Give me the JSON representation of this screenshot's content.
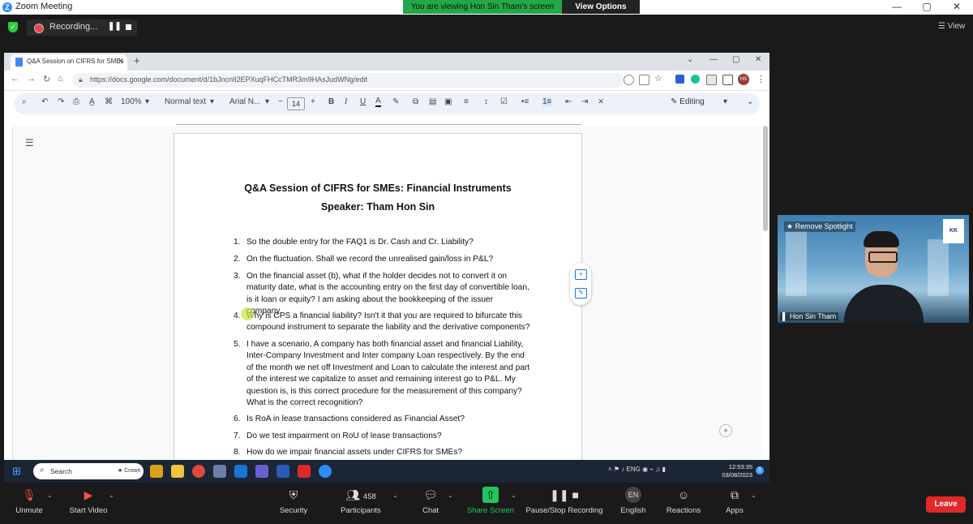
{
  "zoom": {
    "title": "Zoom Meeting",
    "logo": "Z",
    "viewing_banner": "You are viewing Hon Sin Tham's screen",
    "view_options": "View Options",
    "recording_label": "Recording...",
    "view_menu": "☰ View",
    "minimize": "—",
    "maximize": "▢",
    "close": "✕"
  },
  "browser": {
    "tab_title": "Q&A Session on CIFRS for SMEs",
    "tab_close": "✕",
    "new_tab": "+",
    "url": "https://docs.google.com/document/d/1bJncnlI2EPXuqFHCcTMR3m9HAsJudWNg/edit",
    "profile_initials": "HS",
    "back": "←",
    "forward": "→",
    "reload": "↻",
    "home": "⌂",
    "window_controls": [
      "⌄",
      "—",
      "▢",
      "✕"
    ]
  },
  "docs_toolbar": {
    "search": "⌕",
    "undo": "↶",
    "redo": "↷",
    "print": "⎙",
    "spellcheck": "A̲",
    "paint_format": "⌘",
    "zoom": "100%",
    "style": "Normal text",
    "font": "Arial N...",
    "minus": "−",
    "font_size": "14",
    "plus": "+",
    "bold": "B",
    "italic": "I",
    "underline": "U",
    "text_color": "A",
    "highlight": "✎",
    "link": "⧉",
    "comment": "▤",
    "image": "▣",
    "align": "≡",
    "line_spacing": "↕",
    "checklist": "☑",
    "bullets": "•≡",
    "numbered": "1≡",
    "indent_less": "⇤",
    "indent_more": "⇥",
    "clear_format": "⨯",
    "editing": "✎  Editing",
    "collapse": "⌄",
    "dropdown": "▾"
  },
  "document": {
    "title": "Q&A Session of CIFRS for SMEs: Financial Instruments",
    "speaker": "Speaker: Tham Hon Sin",
    "questions": [
      {
        "num": "1.",
        "text": "So the double entry for the FAQ1 is Dr. Cash and Cr. Liability?"
      },
      {
        "num": "2.",
        "text": "On the fluctuation. Shall we record the unrealised gain/loss in P&L?"
      },
      {
        "num": "3.",
        "text": "On the financial asset (b), what if the holder decides not to convert it on maturity date, what is the accounting entry on the first day of convertible loan, is it loan or equity? I am asking about the bookkeeping of the issuer company."
      },
      {
        "num": "4.",
        "text": "Why is CPS a financial liability? Isn't it that you are required to bifurcate this compound instrument to separate the liability and the derivative components?"
      },
      {
        "num": "5.",
        "text": "I have a scenario, A company has both financial asset and financial Liability, Inter-Company Investment and Inter company Loan respectively.  By the end of the month we net off Investment and Loan to calculate the interest and part of the interest we capitalize to asset and remaining interest go to P&L. My question is, is this correct procedure for the measurement of this company? What is the correct recognition?"
      },
      {
        "num": "6.",
        "text": "Is RoA in lease transactions considered as Financial Asset?"
      },
      {
        "num": "7.",
        "text": "Do we test impairment on RoU of lease transactions?"
      },
      {
        "num": "8.",
        "text": "How do we impair financial assets under CIFRS for SMEs?"
      }
    ]
  },
  "taskbar": {
    "search_placeholder": "Search",
    "search_badge": "★ Crown",
    "tray_text": "˄   ⚑   ♪   ENG   ◉  ⌁  ♫  ▮",
    "time": "12:53:35",
    "date": "03/08/2023",
    "notifications": "1"
  },
  "speaker_tile": {
    "spotlight": "★ Remove Spotlight",
    "name": "▌ Hon Sin Tham",
    "logo_text": "KK"
  },
  "controls": {
    "unmute": "Unmute",
    "start_video": "Start Video",
    "security": "Security",
    "participants": "Participants",
    "participants_count": "458",
    "chat": "Chat",
    "share_screen": "Share Screen",
    "pause_stop_recording": "Pause/Stop Recording",
    "english": "English",
    "english_badge": "EN",
    "reactions": "Reactions",
    "apps": "Apps",
    "leave": "Leave"
  },
  "colors": {
    "banner_green": "#22a846",
    "leave_red": "#e02828",
    "docs_toolbar_bg": "#edf2fa",
    "zoom_bar_bg": "#1a1a1a"
  }
}
